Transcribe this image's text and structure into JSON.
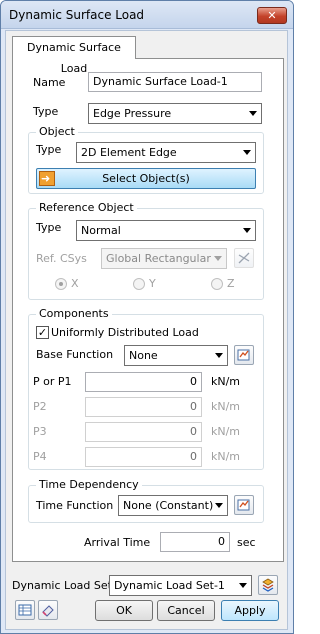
{
  "window": {
    "title": "Dynamic Surface Load",
    "close_glyph": "✕"
  },
  "tab": {
    "label": "Dynamic Surface Load"
  },
  "name": {
    "label": "Name",
    "value": "Dynamic Surface Load-1"
  },
  "type": {
    "label": "Type",
    "value": "Edge Pressure"
  },
  "object": {
    "group_title": "Object",
    "type_label": "Type",
    "type_value": "2D Element Edge",
    "select_button": "Select Object(s)"
  },
  "reference": {
    "group_title": "Reference Object",
    "type_label": "Type",
    "type_value": "Normal",
    "csys_label": "Ref. CSys",
    "csys_value": "Global Rectangular",
    "axes": [
      {
        "label": "X",
        "checked": true
      },
      {
        "label": "Y",
        "checked": false
      },
      {
        "label": "Z",
        "checked": false
      }
    ]
  },
  "components": {
    "group_title": "Components",
    "uniform_label": "Uniformly Distributed Load",
    "uniform_checked": true,
    "check_glyph": "✓",
    "base_function_label": "Base Function",
    "base_function_value": "None",
    "rows": [
      {
        "label": "P or P1",
        "value": "0",
        "unit": "kN/m",
        "enabled": true
      },
      {
        "label": "P2",
        "value": "0",
        "unit": "kN/m",
        "enabled": false
      },
      {
        "label": "P3",
        "value": "0",
        "unit": "kN/m",
        "enabled": false
      },
      {
        "label": "P4",
        "value": "0",
        "unit": "kN/m",
        "enabled": false
      }
    ]
  },
  "time": {
    "group_title": "Time Dependency",
    "function_label": "Time Function",
    "function_value": "None (Constant)"
  },
  "arrival": {
    "label": "Arrival Time",
    "value": "0",
    "unit": "sec"
  },
  "load_set": {
    "label": "Dynamic Load Set",
    "value": "Dynamic Load Set-1"
  },
  "buttons": {
    "ok": "OK",
    "cancel": "Cancel",
    "apply": "Apply"
  }
}
